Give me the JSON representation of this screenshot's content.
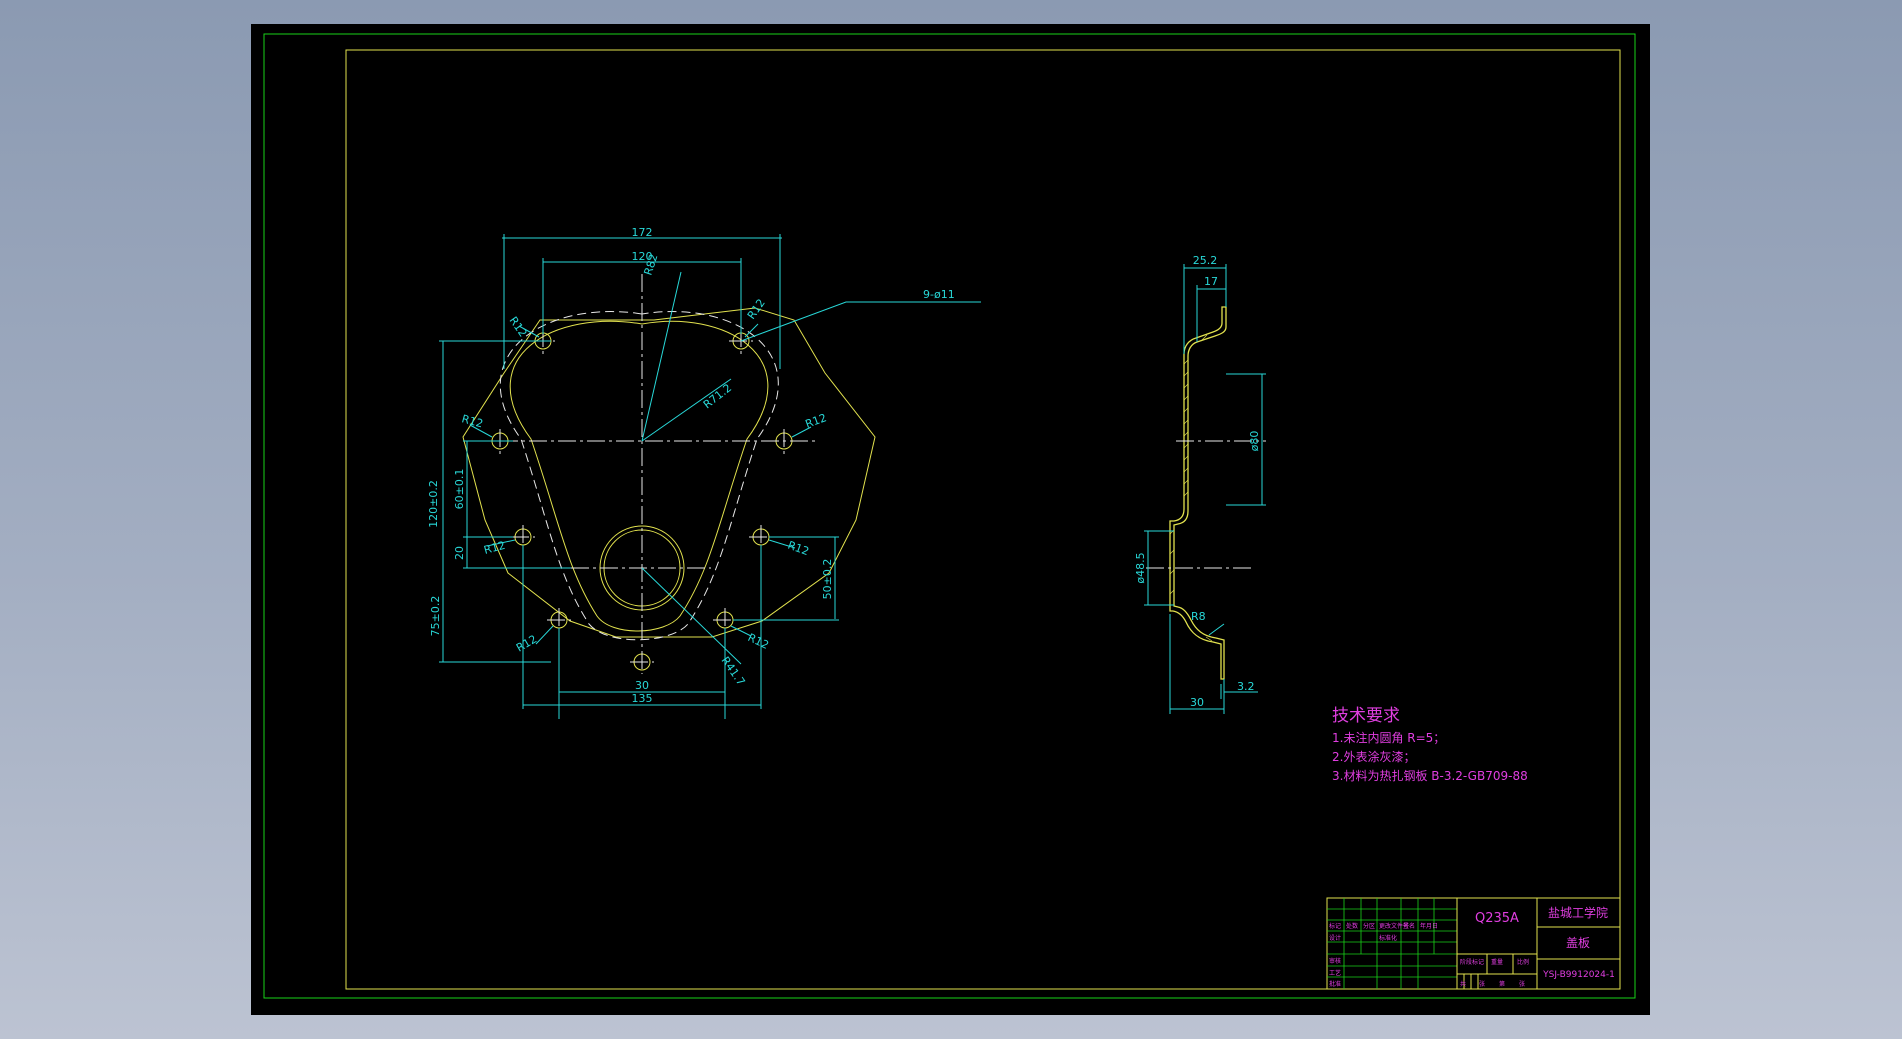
{
  "drawing": {
    "dims": {
      "w172": "172",
      "w120": "120",
      "r82": "R82",
      "r12a": "R12",
      "r12b": "R12",
      "hole_note": "9-ø11",
      "r71": "R71.2",
      "r12c": "R12",
      "r12d": "R12",
      "r12e": "R12",
      "r12f": "R12",
      "r12g": "R12",
      "r12h": "R12",
      "h120": "120±0.2",
      "h60": "60±0.1",
      "h20": "20",
      "h75": "75±0.2",
      "h50": "50±0.2",
      "r41": "R41.7",
      "w30": "30",
      "w135": "135",
      "s25": "25.2",
      "s17": "17",
      "s80": "ø80",
      "s48": "ø48.5",
      "s8": "R8",
      "s3": "3.2",
      "s30": "30"
    },
    "tech": {
      "heading": "技术要求",
      "line1": "1.未注内圆角 R=5；",
      "line2": "2.外表涂灰漆；",
      "line3": "3.材料为热扎钢板 B-3.2-GB709-88"
    },
    "title_block": {
      "material": "Q235A",
      "school": "盐城工学院",
      "part_name": "盖板",
      "drawing_no": "YSJ-B9912024-1",
      "row_labels": [
        "标记",
        "处数",
        "分区",
        "更改文件号",
        "签名",
        "年月日"
      ],
      "side_labels": [
        "设计",
        "审核",
        "工艺",
        "标准化",
        "批准"
      ],
      "stage_labels": [
        "阶段标记",
        "重量",
        "比例"
      ],
      "sheet_labels": [
        "共",
        "张",
        "第",
        "张"
      ]
    }
  }
}
